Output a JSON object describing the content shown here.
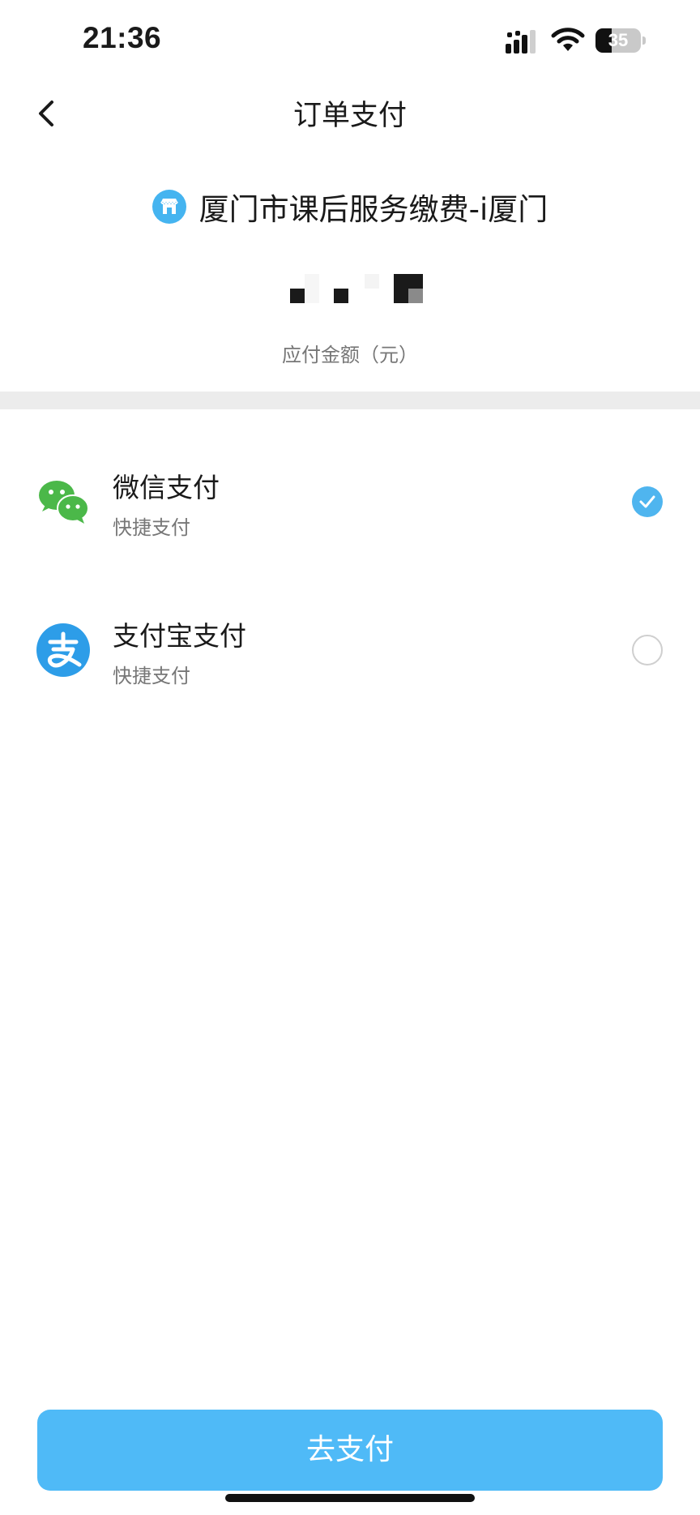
{
  "status_bar": {
    "time": "21:36",
    "battery_level": "35",
    "battery_fraction": 0.35,
    "icons": [
      "cellular-signal-icon",
      "wifi-icon",
      "battery-icon"
    ]
  },
  "nav": {
    "back_icon": "chevron-left-icon",
    "title": "订单支付"
  },
  "merchant": {
    "icon": "store-icon",
    "name": "厦门市课后服务缴费-i厦门"
  },
  "amount": {
    "value": "",
    "label": "应付金额（元）"
  },
  "payment_methods": [
    {
      "id": "wechat",
      "icon": "wechat-pay-icon",
      "title": "微信支付",
      "subtitle": "快捷支付",
      "selected": true
    },
    {
      "id": "alipay",
      "icon": "alipay-icon",
      "title": "支付宝支付",
      "subtitle": "快捷支付",
      "selected": false
    }
  ],
  "footer": {
    "pay_button_label": "去支付"
  },
  "colors": {
    "accent": "#4fbaf7",
    "check": "#4fb5ef",
    "wechat_green": "#4bb849",
    "alipay_blue": "#2d9de8",
    "divider": "#ececec"
  }
}
